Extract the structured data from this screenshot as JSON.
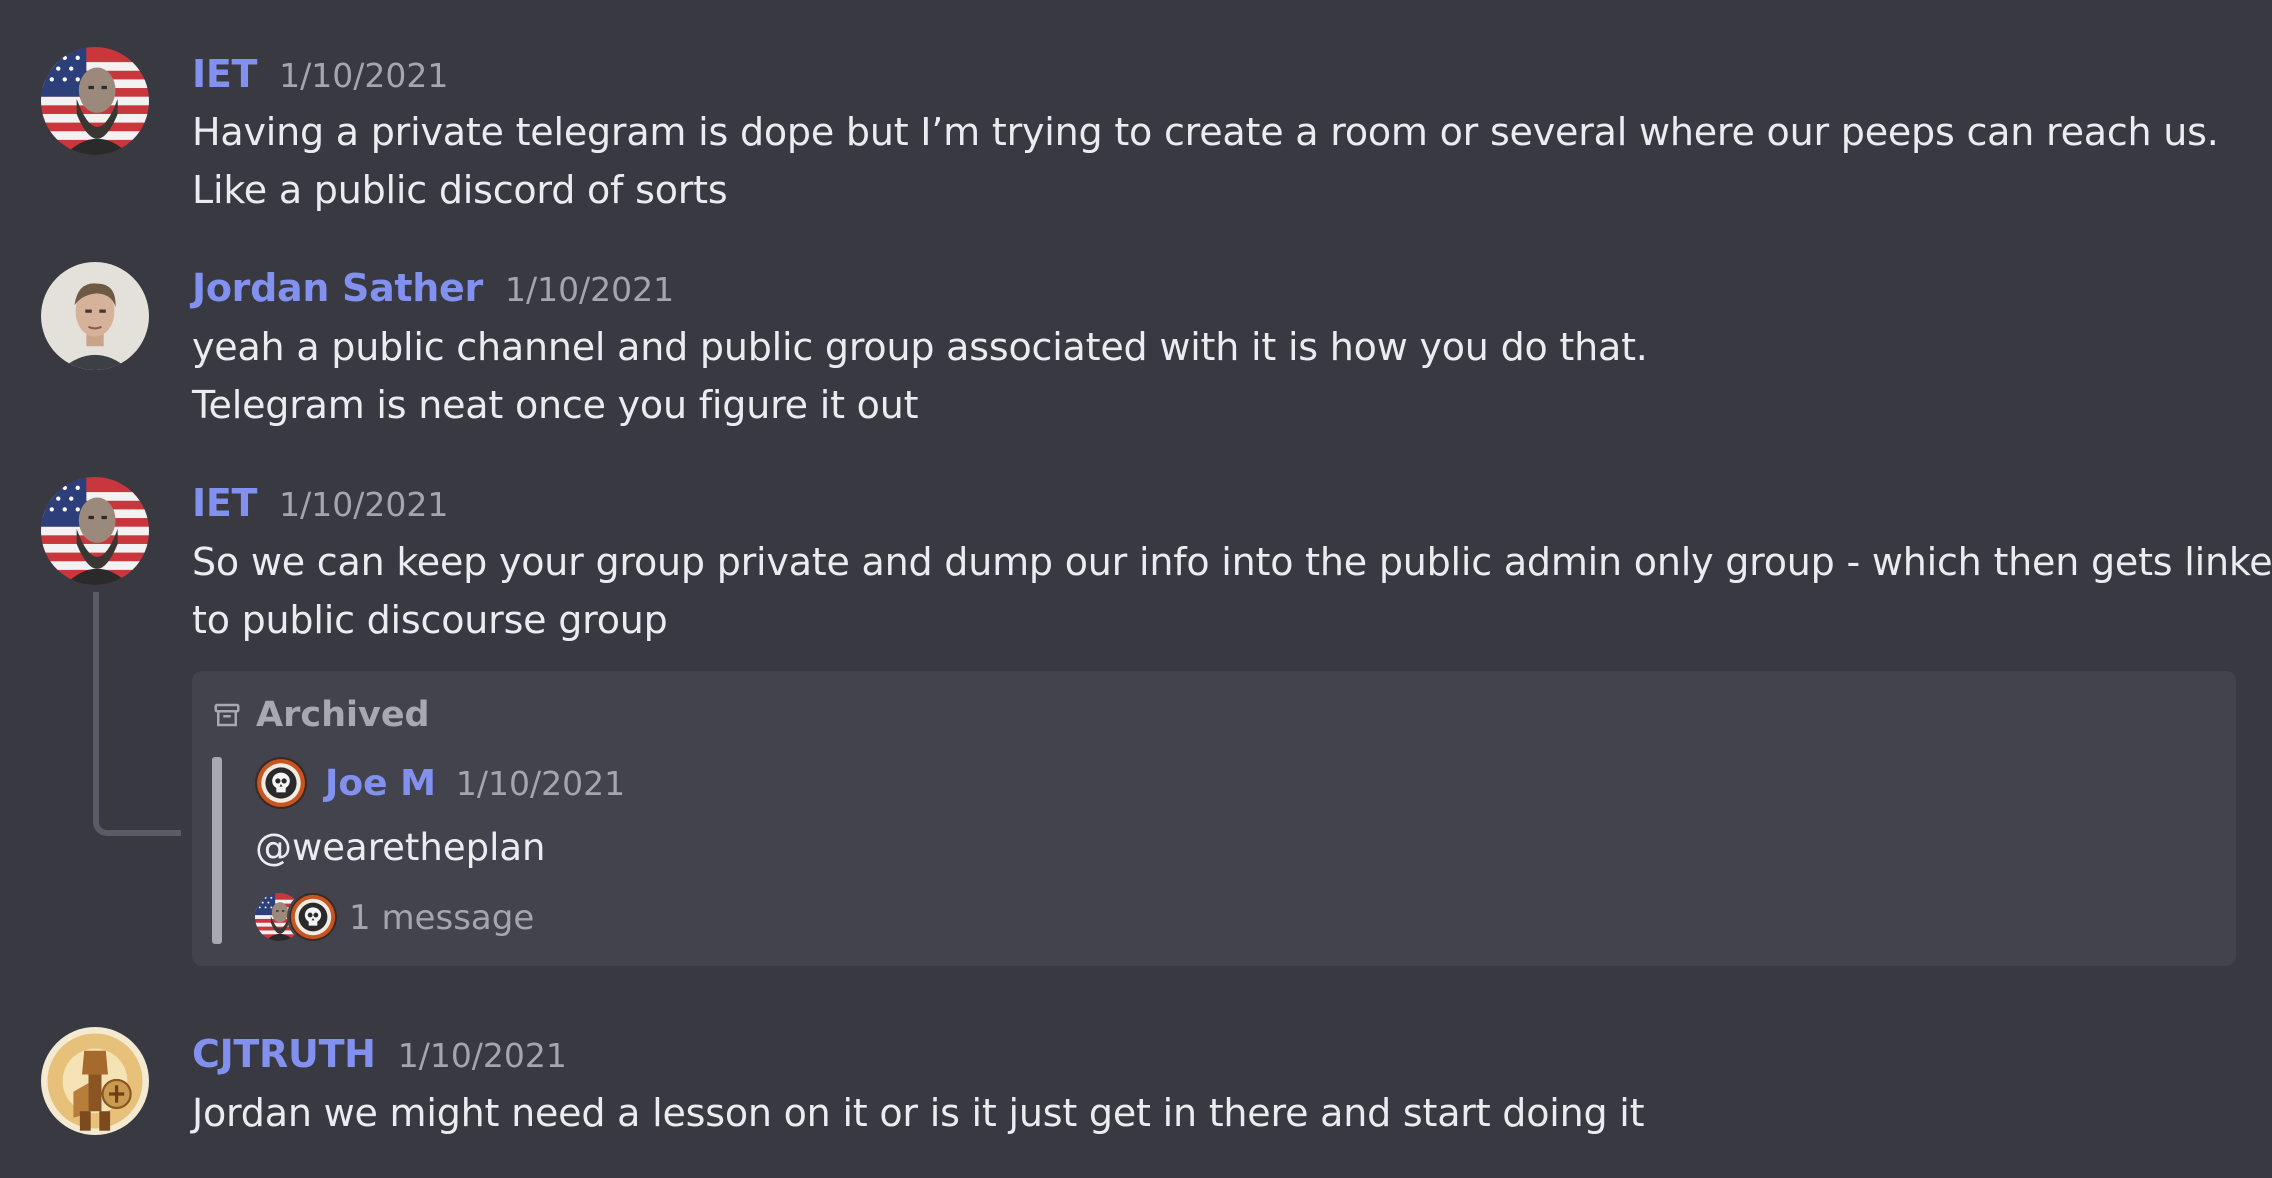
{
  "messages": [
    {
      "author": "IET",
      "date": "1/10/2021",
      "lines": [
        "Having a private telegram is dope but I’m trying to create a room or several where our peeps can reach us.",
        "Like a public discord of sorts"
      ],
      "avatar_icon": "flag-portrait-avatar"
    },
    {
      "author": "Jordan Sather",
      "date": "1/10/2021",
      "lines": [
        "yeah a public channel and public group associated with it is how you do that.",
        "Telegram is neat once you figure it out"
      ],
      "avatar_icon": "portrait-avatar"
    },
    {
      "author": "IET",
      "date": "1/10/2021",
      "lines": [
        "So we can keep your group private and dump our info into the public admin only group - which then gets linked",
        "to public discourse group"
      ],
      "avatar_icon": "flag-portrait-avatar"
    },
    {
      "author": "CJTRUTH",
      "date": "1/10/2021",
      "lines": [
        "Jordan we might need a lesson on it or is it just get in there and start doing it"
      ],
      "avatar_icon": "knight-avatar"
    }
  ],
  "thread": {
    "status_label": "Archived",
    "status_icon": "archive-icon",
    "author": "Joe M",
    "date": "1/10/2021",
    "text": "@wearetheplan",
    "message_count": "1 message",
    "avatar_icon": "skull-badge-avatar"
  },
  "colors": {
    "background": "#393942",
    "author": "#8290ef",
    "card": "#43434e",
    "muted": "#a4a5ad"
  }
}
